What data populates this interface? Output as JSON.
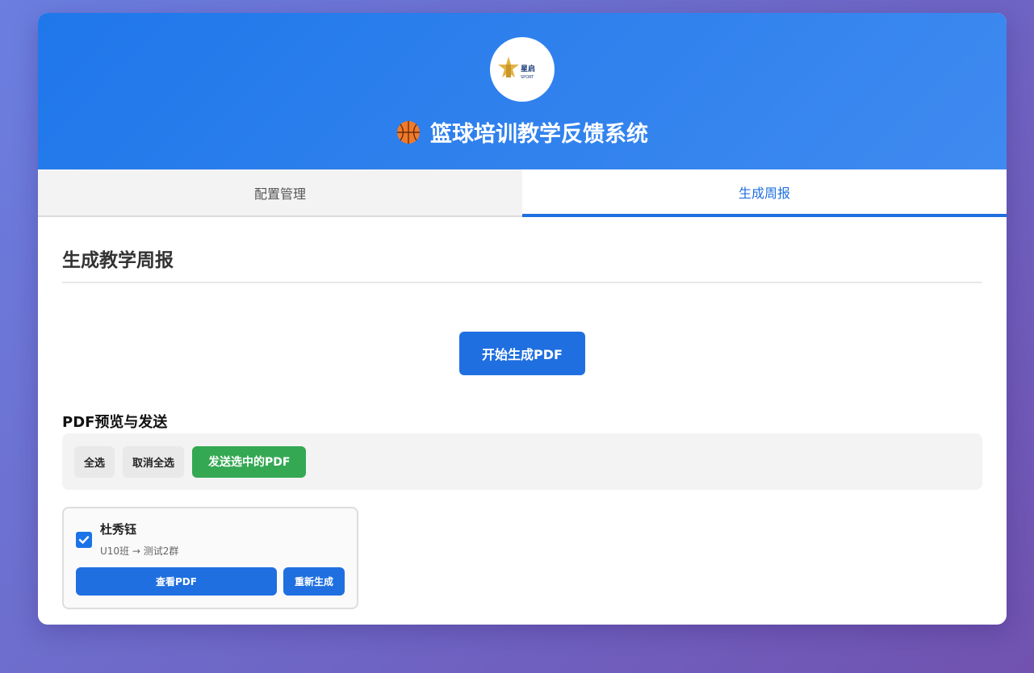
{
  "header": {
    "app_title": "篮球培训教学反馈系统",
    "title_icon": "basketball-icon",
    "logo_icon": "company-logo-icon",
    "logo_text": "星启运动体育"
  },
  "tabs": [
    {
      "label": "配置管理",
      "active": false
    },
    {
      "label": "生成周报",
      "active": true
    }
  ],
  "main": {
    "section_title": "生成教学周报",
    "generate_button": "开始生成PDF",
    "preview_title": "PDF预览与发送",
    "toolbar": {
      "select_all": "全选",
      "deselect_all": "取消全选",
      "send_selected": "发送选中的PDF"
    },
    "pdf_cards": [
      {
        "student_name": "杜秀钰",
        "meta": "U10班 → 测试2群",
        "checked": true,
        "view_button": "查看PDF",
        "regenerate_button": "重新生成"
      }
    ]
  },
  "colors": {
    "primary": "#1f6fe0",
    "success": "#34a853",
    "header_gradient_start": "#1f77ea",
    "header_gradient_end": "#3f8af0",
    "background_gradient_start": "#6b7fe0",
    "background_gradient_end": "#7152b0"
  }
}
